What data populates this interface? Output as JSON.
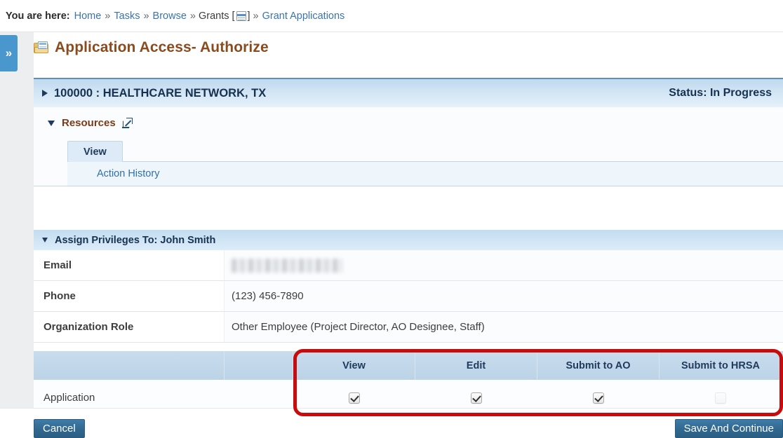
{
  "breadcrumb": {
    "label": "You are here:",
    "items": [
      {
        "text": "Home",
        "type": "link"
      },
      {
        "text": "Tasks",
        "type": "link"
      },
      {
        "text": "Browse",
        "type": "link"
      },
      {
        "text": "Grants",
        "type": "plain"
      },
      {
        "text": "Grant Applications",
        "type": "link"
      }
    ],
    "separator": "»",
    "bracket_open": "[",
    "bracket_close": "]",
    "grid_icon": "grid-icon"
  },
  "sidebar": {
    "toggle_label": "»",
    "toggle_icon": "double-chevron-right-icon",
    "color": "#4a97cd"
  },
  "page": {
    "title": "Application Access- Authorize",
    "title_color": "#8a4b1e",
    "title_icon": "folder-icon"
  },
  "org_header": {
    "caret_icon": "caret-right-icon",
    "id": "100000",
    "separator": ":",
    "name": "HEALTHCARE NETWORK, TX",
    "full_title": "100000 : HEALTHCARE NETWORK, TX",
    "status": "Status: In Progress",
    "status_value": "In Progress"
  },
  "resources": {
    "caret_icon": "caret-down-icon",
    "label": "Resources",
    "external_link_icon": "external-link-icon",
    "tabs": [
      {
        "label": "View",
        "active": true
      }
    ],
    "links": [
      {
        "label": "Action History"
      }
    ]
  },
  "assign": {
    "caret_icon": "caret-down-icon",
    "title": "Assign Privileges To: John Smith",
    "person_name": "John Smith",
    "fields": [
      {
        "label": "Email",
        "value": "",
        "redacted": true
      },
      {
        "label": "Phone",
        "value": "(123) 456-7890",
        "redacted": false
      },
      {
        "label": "Organization Role",
        "value": "Other Employee (Project Director, AO Designee, Staff)",
        "redacted": false
      }
    ]
  },
  "permissions": {
    "columns": [
      "",
      "",
      "View",
      "Edit",
      "Submit to AO",
      "Submit to HRSA"
    ],
    "perm_columns": [
      "View",
      "Edit",
      "Submit to AO",
      "Submit to HRSA"
    ],
    "rows": [
      {
        "name": "Application",
        "values": [
          true,
          true,
          true,
          false
        ]
      }
    ],
    "highlight_color": "#c60c0c"
  },
  "footer": {
    "cancel_label": "Cancel",
    "save_label": "Save And Continue"
  }
}
